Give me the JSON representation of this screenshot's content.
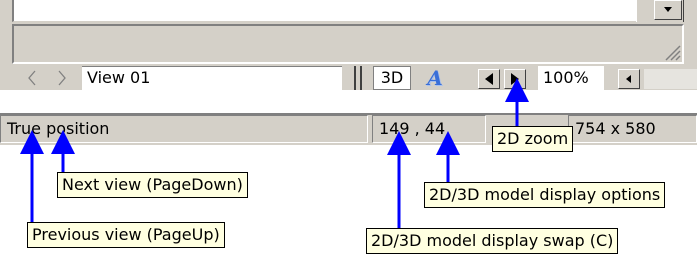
{
  "toolbar": {
    "view_name": "View 01",
    "btn_3d_label": "3D",
    "btn_a_label": "A",
    "zoom_value": "100%"
  },
  "status_bar": {
    "mode_text": "True position",
    "coords_text": "149 , 44",
    "size_text": "754 x 580"
  },
  "callouts": {
    "zoom": "2D zoom",
    "next_view": "Next view (PageDown)",
    "previous_view": "Previous view (PageUp)",
    "display_options": "2D/3D model display options",
    "display_swap": "2D/3D model display swap (C)"
  },
  "colors": {
    "window_bg": "#d4d0c8",
    "tooltip_bg": "#ffffe1",
    "arrow_blue": "#0000ff",
    "accent_a": "#3a6fd8"
  }
}
